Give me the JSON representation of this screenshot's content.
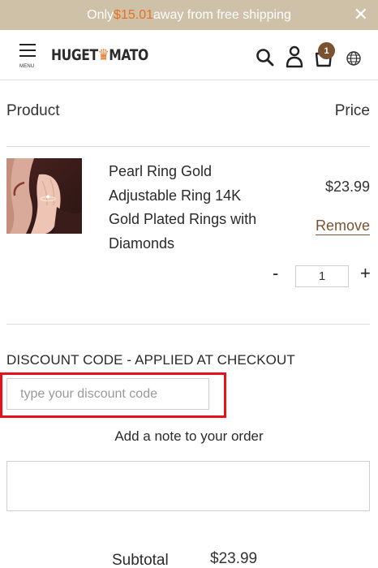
{
  "promo": {
    "text_before": "Only ",
    "amount": "$15.01",
    "text_after": " away from free shipping",
    "close_glyph": "✕"
  },
  "header": {
    "menu_label": "MENU",
    "logo_left": "HUGET",
    "logo_crown": "♛",
    "logo_right": "MATO",
    "cart_count": "1",
    "icons": [
      "menu-icon",
      "search-icon",
      "account-icon",
      "cart-icon",
      "globe-icon"
    ]
  },
  "cart": {
    "col_product": "Product",
    "col_price": "Price",
    "items": [
      {
        "name": "Pearl Ring Gold Adjustable Ring 14K Gold Plated Rings with Diamonds",
        "price": "$23.99",
        "remove_label": "Remove",
        "minus": "-",
        "plus": "+",
        "quantity": "1"
      }
    ]
  },
  "discount": {
    "label": "DISCOUNT CODE - APPLIED AT CHECKOUT",
    "placeholder": "type your discount code",
    "highlight_color": "#e8101a"
  },
  "note": {
    "label": "Add a note to your order",
    "value": ""
  },
  "summary": {
    "subtotal_label": "Subtotal",
    "subtotal_value": "$23.99"
  },
  "colors": {
    "promo_bg": "#cfc0a8",
    "promo_amount": "#e8701f",
    "accent_brown": "#7a5232"
  }
}
